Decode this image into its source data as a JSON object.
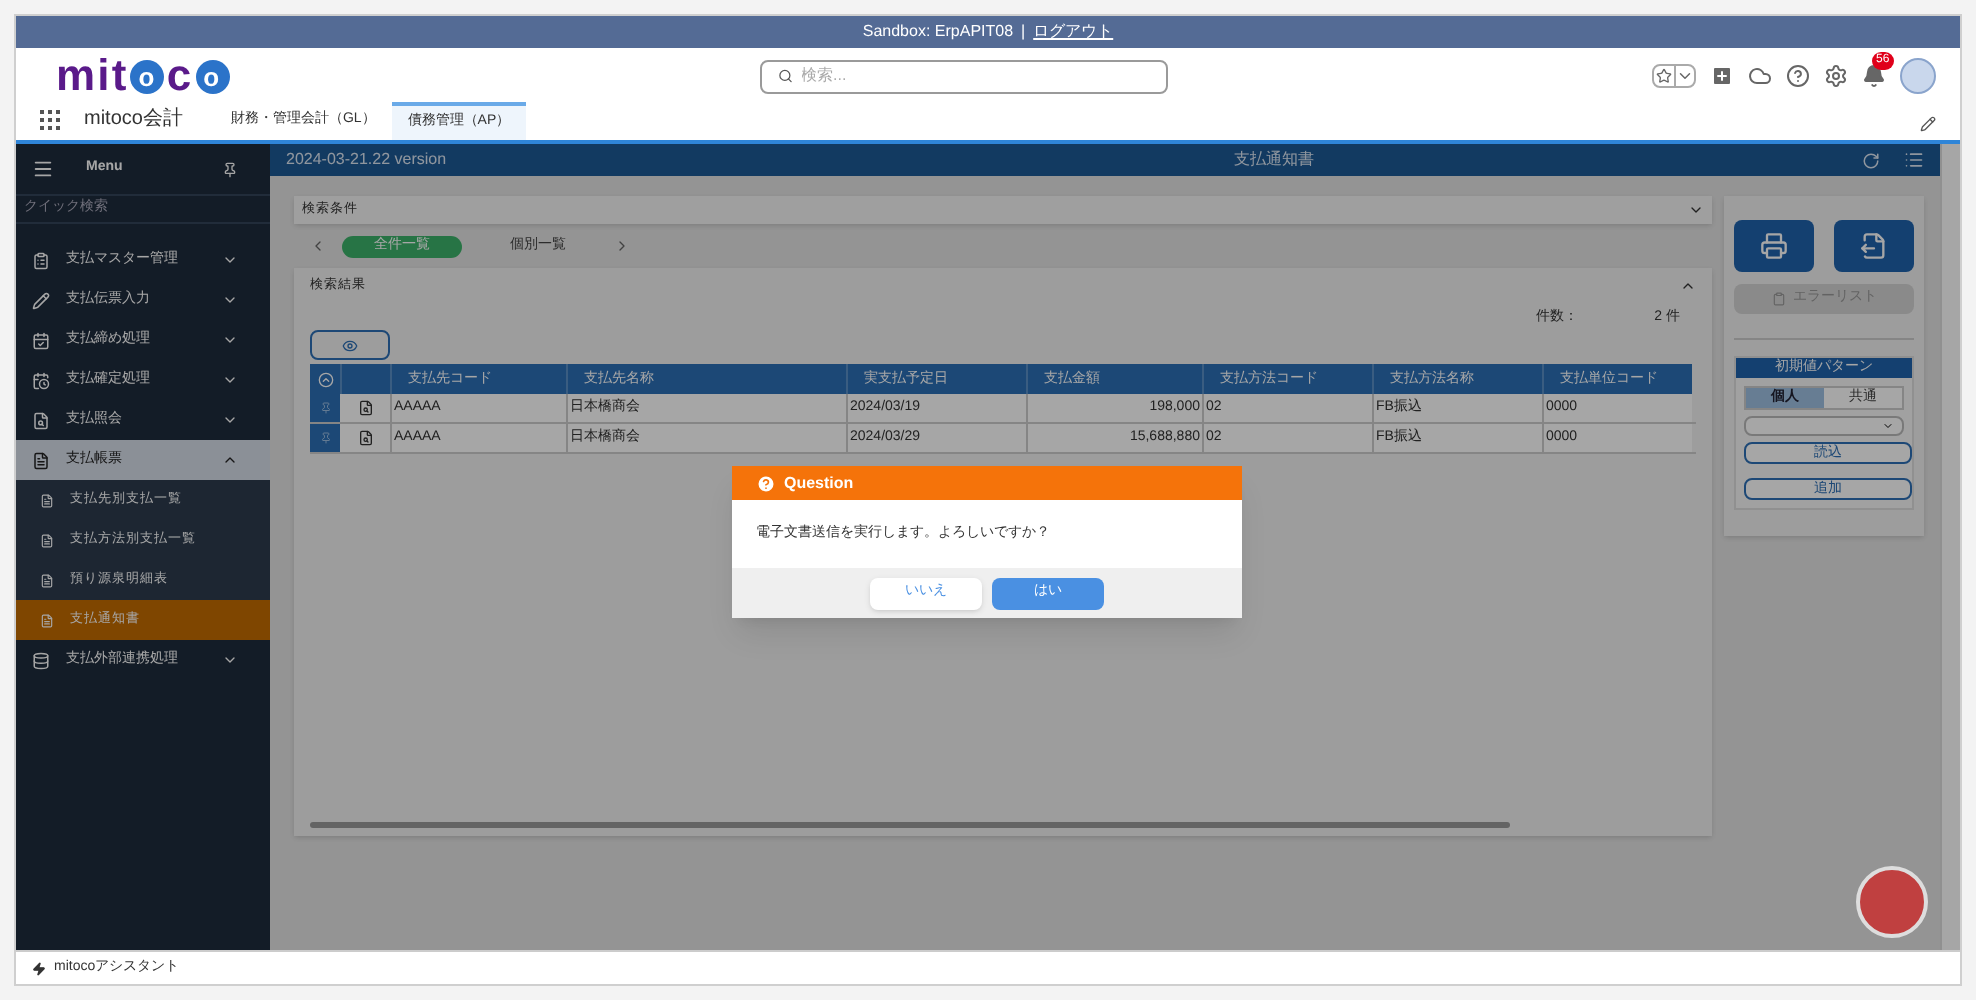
{
  "sandbox_bar": {
    "org": "Sandbox: ErpAPIT08",
    "separator": "|",
    "logout": "ログアウト"
  },
  "header": {
    "logo": "mitoco",
    "search": {
      "placeholder": "検索..."
    },
    "notification_count": "56"
  },
  "nav": {
    "app_name": "mitoco会計",
    "tabs": [
      {
        "label": "財務・管理会計（GL）",
        "selected": false
      },
      {
        "label": "債務管理（AP）",
        "selected": true
      }
    ]
  },
  "sidebar": {
    "title": "Menu",
    "quick_search": {
      "placeholder": "クイック検索"
    },
    "items": [
      {
        "label": "支払マスター管理",
        "expanded": false,
        "selected": false
      },
      {
        "label": "支払伝票入力",
        "expanded": false,
        "selected": false
      },
      {
        "label": "支払締め処理",
        "expanded": false,
        "selected": false
      },
      {
        "label": "支払確定処理",
        "expanded": false,
        "selected": false
      },
      {
        "label": "支払照会",
        "expanded": false,
        "selected": false
      },
      {
        "label": "支払帳票",
        "expanded": true,
        "selected": false,
        "children": [
          {
            "label": "支払先別支払一覧",
            "selected": false
          },
          {
            "label": "支払方法別支払一覧",
            "selected": false
          },
          {
            "label": "預り源泉明細表",
            "selected": false
          },
          {
            "label": "支払通知書",
            "selected": true
          }
        ]
      },
      {
        "label": "支払外部連携処理",
        "expanded": false,
        "selected": false
      }
    ]
  },
  "version_bar": {
    "version": "2024-03-21.22 version",
    "title": "支払通知書"
  },
  "search_conditions": {
    "title": "検索条件",
    "tabs": [
      {
        "label": "全件一覧",
        "selected": true
      },
      {
        "label": "個別一覧",
        "selected": false
      }
    ]
  },
  "results": {
    "title": "検索結果",
    "count_label": "件数：",
    "count": "2 件",
    "table": {
      "columns": [
        "支払先コード",
        "支払先名称",
        "実支払予定日",
        "支払金額",
        "支払方法コード",
        "支払方法名称",
        "支払単位コード"
      ],
      "rows": [
        [
          "AAAAA",
          "日本橋商会",
          "2024/03/19",
          "198,000",
          "02",
          "FB振込",
          "0000"
        ],
        [
          "AAAAA",
          "日本橋商会",
          "2024/03/29",
          "15,688,880",
          "02",
          "FB振込",
          "0000"
        ]
      ]
    }
  },
  "side_panel": {
    "error_list": {
      "label": "エラーリスト",
      "disabled": true
    },
    "pattern": {
      "title": "初期値パターン",
      "tabs": [
        {
          "label": "個人",
          "selected": true
        },
        {
          "label": "共通",
          "selected": false
        }
      ],
      "load": "読込",
      "add": "追加"
    }
  },
  "dialog": {
    "title": "Question",
    "message": "電子文書送信を実行します。よろしいですか？",
    "buttons": [
      {
        "label": "いいえ",
        "kind": "secondary"
      },
      {
        "label": "はい",
        "kind": "primary"
      }
    ]
  },
  "assistant_bar": {
    "label": "mitocoアシスタント"
  }
}
